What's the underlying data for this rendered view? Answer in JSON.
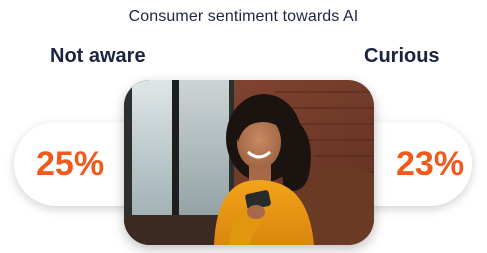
{
  "title": "Consumer sentiment towards AI",
  "left_stat": {
    "label": "Not aware",
    "value": "25%"
  },
  "right_stat": {
    "label": "Curious",
    "value": "23%"
  },
  "accent_color": "#f05a1d",
  "photo": "woman-smiling-at-phone-photo"
}
